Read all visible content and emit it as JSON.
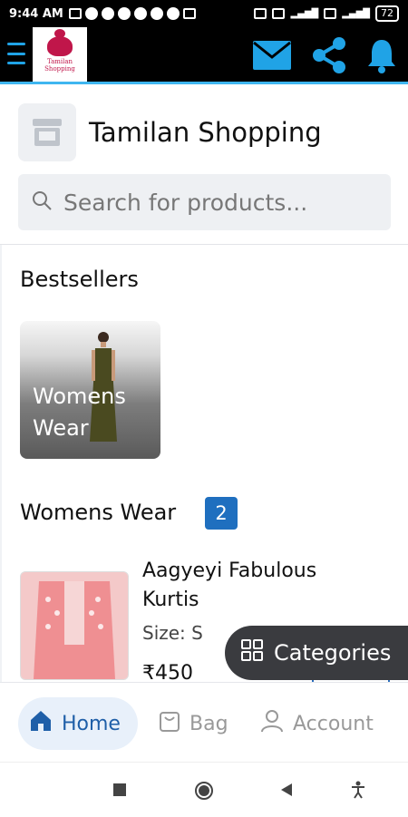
{
  "status_bar": {
    "time": "9:44 AM",
    "battery": "72"
  },
  "app_bar": {
    "logo_text": "Tamilan Shopping",
    "icons": [
      "menu-icon",
      "mail-icon",
      "share-icon",
      "bell-icon"
    ],
    "accent_color": "#3fb6f0"
  },
  "store": {
    "name": "Tamilan Shopping",
    "icon": "store-icon"
  },
  "search": {
    "placeholder": "Search for products...",
    "icon": "search-icon"
  },
  "bestsellers": {
    "title": "Bestsellers",
    "cards": [
      {
        "label": "Womens Wear"
      }
    ]
  },
  "category_section": {
    "title": "Womens Wear",
    "count": "2",
    "products": [
      {
        "name": "Aagyeyi Fabulous Kurtis",
        "size": "Size: S",
        "price": "₹450"
      }
    ]
  },
  "fab": {
    "label": "Categories",
    "icon": "grid-icon"
  },
  "bottom_nav": {
    "items": [
      {
        "label": "Home",
        "icon": "home-icon",
        "active": true
      },
      {
        "label": "Bag",
        "icon": "bag-icon",
        "active": false
      },
      {
        "label": "Account",
        "icon": "account-icon",
        "active": false
      }
    ],
    "active_color": "#1f5fa8"
  }
}
